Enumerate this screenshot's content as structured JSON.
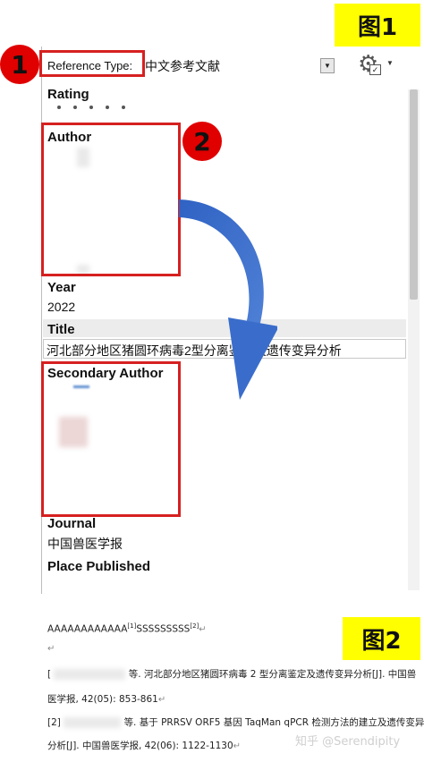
{
  "labels": {
    "fig1": "图1",
    "fig2": "图2",
    "badge1": "1",
    "badge2": "2"
  },
  "reference_type": {
    "label": "Reference Type:",
    "value": "中文参考文献"
  },
  "fields": {
    "rating": "Rating",
    "author": "Author",
    "year": "Year",
    "year_value": "2022",
    "title": "Title",
    "title_value": "河北部分地区猪圆环病毒2型分离鉴定及遗传变异分析",
    "secondary_author": "Secondary Author",
    "journal": "Journal",
    "journal_value": "中国兽医学报",
    "place_published": "Place Published"
  },
  "document": {
    "line1_main": "AAAAAAAAAAAA",
    "line1_sup1": "[1]",
    "line1_mid": "SSSSSSSSS",
    "line1_sup2": "[2]",
    "ref1_a": "[",
    "ref1_b": "等. 河北部分地区猪圆环病毒 2 型分离鉴定及遗传变异分析[J]. 中国兽",
    "ref1_c": "医学报, 42(05): 853-861",
    "ref2_a": "[2]",
    "ref2_b": "等. 基于 PRRSV ORF5 基因 TaqMan qPCR 检测方法的建立及遗传变异",
    "ref2_c": "分析[J]. 中国兽医学报, 42(06): 1122-1130"
  },
  "watermark": "知乎 @Serendipity",
  "icons": {
    "gear": "gear-icon",
    "dropdown": "dropdown-arrow-icon"
  },
  "colors": {
    "highlight": "#ffff00",
    "annotation_red": "#d62020",
    "arrow_blue": "#2f62c3"
  }
}
